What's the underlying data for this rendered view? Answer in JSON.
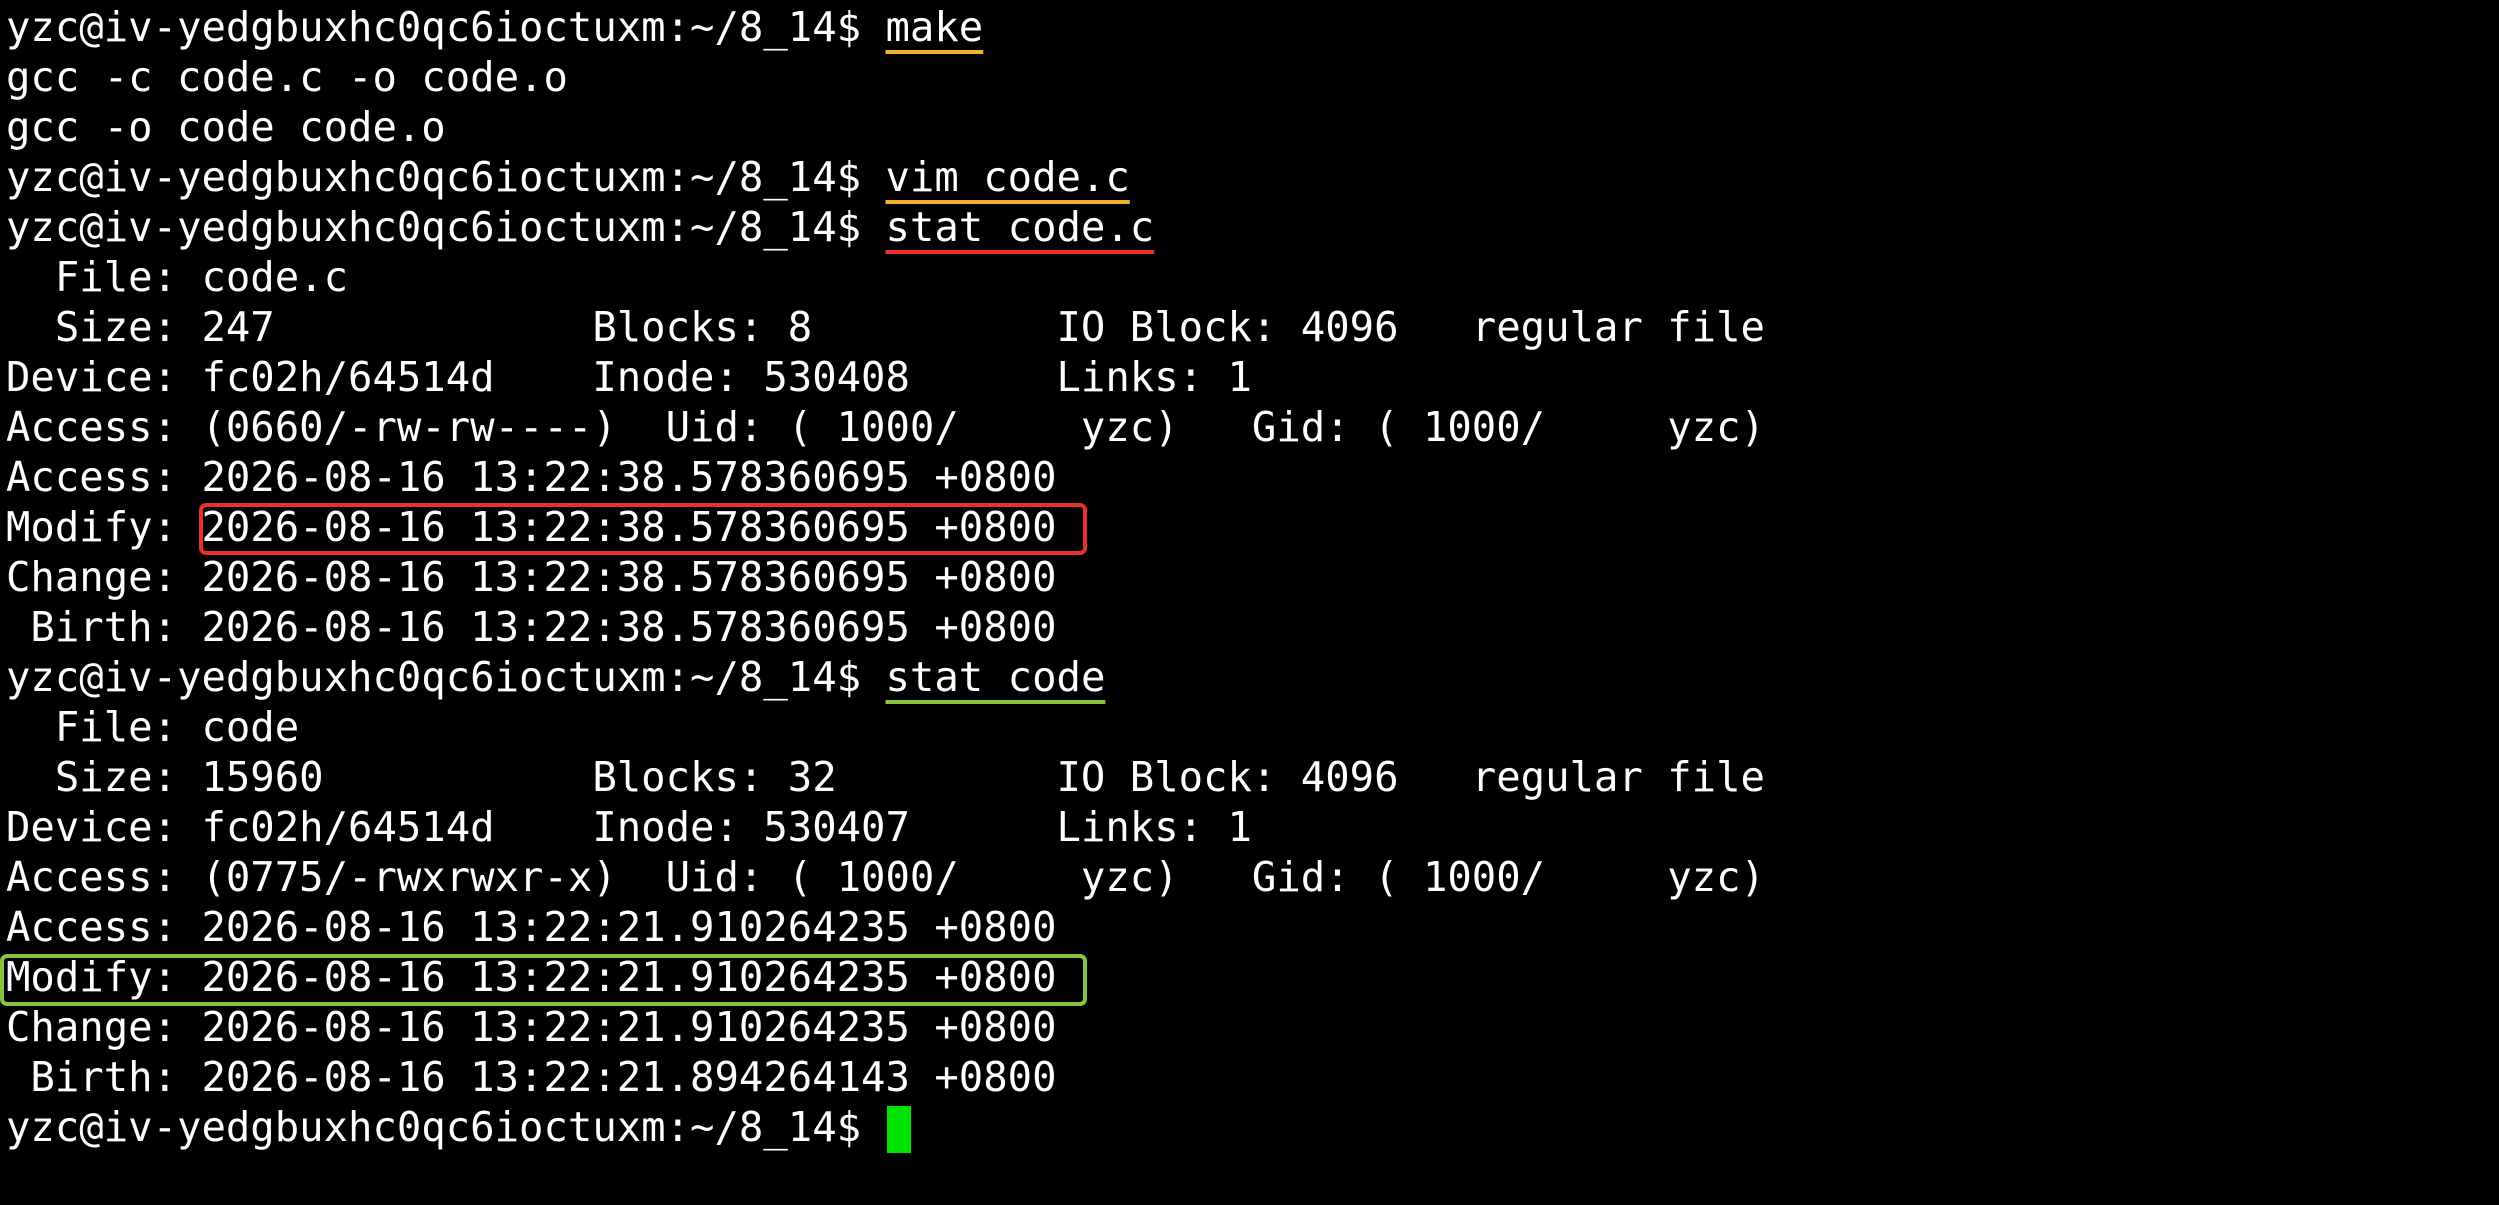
{
  "terminal": {
    "prompt": "yzc@iv-yedgbuxhc0qc6ioctuxm:~/8_14$",
    "commands": {
      "make": "make",
      "vim": "vim code.c",
      "stat_c": "stat code.c",
      "stat_bin": "stat code"
    },
    "output": {
      "gcc_compile": "gcc -c code.c -o code.o",
      "gcc_link": "gcc -o code code.o"
    },
    "stat_code_c": {
      "file": "  File: code.c",
      "size": "  Size: 247             Blocks: 8          IO Block: 4096   regular file",
      "device": "Device: fc02h/64514d    Inode: 530408      Links: 1",
      "access_perm": "Access: (0660/-rw-rw----)  Uid: ( 1000/     yzc)   Gid: ( 1000/     yzc)",
      "access_time": "Access: 2026-08-16 13:22:38.578360695 +0800",
      "modify_label": "Modify: ",
      "modify_time": "2026-08-16 13:22:38.578360695 +0800",
      "change_time": "Change: 2026-08-16 13:22:38.578360695 +0800",
      "birth_time": " Birth: 2026-08-16 13:22:38.578360695 +0800"
    },
    "stat_code": {
      "file": "  File: code",
      "size": "  Size: 15960           Blocks: 32         IO Block: 4096   regular file",
      "device": "Device: fc02h/64514d    Inode: 530407      Links: 1",
      "access_perm": "Access: (0775/-rwxrwxr-x)  Uid: ( 1000/     yzc)   Gid: ( 1000/     yzc)",
      "access_time": "Access: 2026-08-16 13:22:21.910264235 +0800",
      "modify_time": "Modify: 2026-08-16 13:22:21.910264235 +0800",
      "change_time": "Change: 2026-08-16 13:22:21.910264235 +0800",
      "birth_time": " Birth: 2026-08-16 13:22:21.894264143 +0800"
    },
    "colors": {
      "background": "#000000",
      "text": "#ffffff",
      "highlight_orange": "#f0b033",
      "highlight_red": "#e8302c",
      "highlight_green": "#88c440",
      "cursor": "#00e100"
    }
  }
}
